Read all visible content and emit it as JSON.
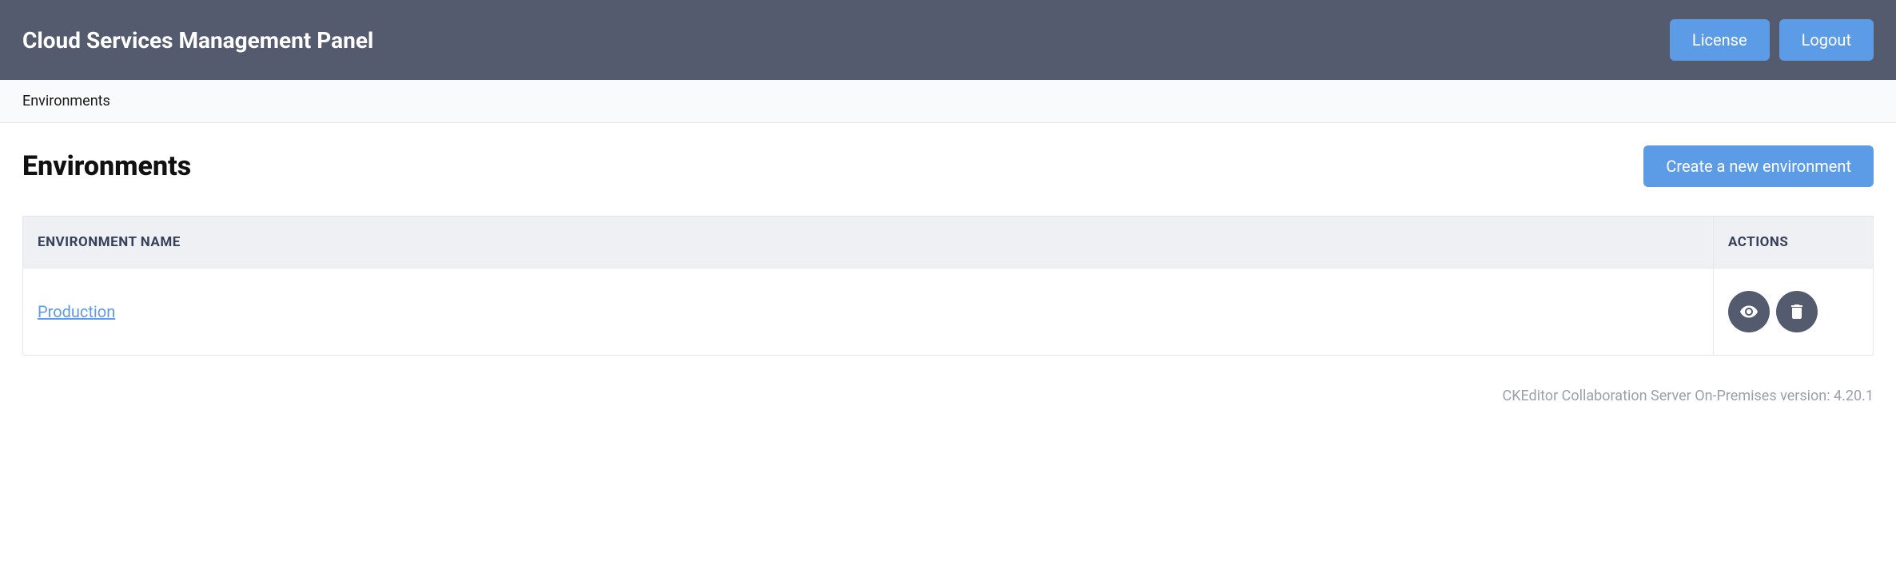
{
  "header": {
    "title": "Cloud Services Management Panel",
    "license_label": "License",
    "logout_label": "Logout"
  },
  "breadcrumb": {
    "current": "Environments"
  },
  "page": {
    "title": "Environments",
    "create_button_label": "Create a new environment"
  },
  "table": {
    "columns": {
      "name": "Environment name",
      "actions": "Actions"
    },
    "rows": [
      {
        "name": "Production"
      }
    ]
  },
  "footer": {
    "version_text": "CKEditor Collaboration Server On-Premises version: 4.20.1"
  }
}
